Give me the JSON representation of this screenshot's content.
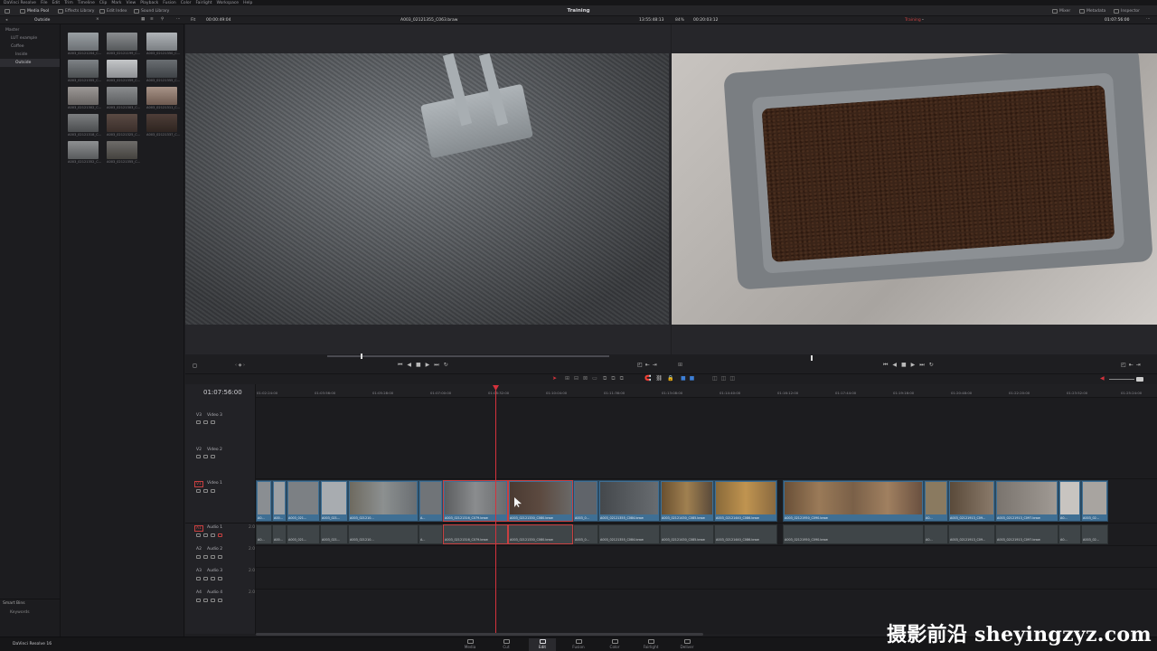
{
  "menubar": [
    "DaVinci Resolve",
    "File",
    "Edit",
    "Trim",
    "Timeline",
    "Clip",
    "Mark",
    "View",
    "Playback",
    "Fusion",
    "Color",
    "Fairlight",
    "Workspace",
    "Help"
  ],
  "toolbar": {
    "media_pool": "Media Pool",
    "effects": "Effects Library",
    "edit_index": "Edit Index",
    "sound_library": "Sound Library",
    "title": "Training",
    "mixer": "Mixer",
    "metadata": "Metadata",
    "inspector": "Inspector"
  },
  "subbar": {
    "bin_name": "Outside",
    "fit": "Fit",
    "source_tc": "00:00:49:04",
    "clip_name": "A003_02121355_C063.braw",
    "duration": "13:55:48:13",
    "zoom": "84%",
    "tl_tc_left": "00:20:03:12",
    "timeline_name": "Training",
    "record_tc": "01:07:56:00"
  },
  "bins": {
    "root": "Master",
    "items": [
      "LUT example",
      "Coffee",
      "Inside",
      "Outside"
    ],
    "selected": "Outside"
  },
  "smart_bins": {
    "title": "Smart Bins",
    "keywords": "Keywords"
  },
  "thumbs": [
    "A003_02121204_C...",
    "A003_02121199_C...",
    "A003_02121350_C...",
    "A003_02121355_C...",
    "A003_02121359_C...",
    "A003_02121355_C...",
    "A003_02121302_C...",
    "A003_02121303_C...",
    "A003_02121311_C...",
    "A003_02121318_C...",
    "A003_02121325_C...",
    "A003_02121337_C...",
    "A003_02121352_C...",
    "A003_02121355_C..."
  ],
  "timeline": {
    "timecode": "01:07:56:00",
    "ruler": [
      "01:02:24:00",
      "01:03:56:00",
      "01:05:28:00",
      "01:07:00:00",
      "01:08:32:00",
      "01:10:04:00",
      "01:11:36:00",
      "01:13:08:00",
      "01:14:40:00",
      "01:16:12:00",
      "01:17:44:00",
      "01:19:16:00",
      "01:20:48:00",
      "01:22:20:00",
      "01:23:52:00",
      "01:25:24:00"
    ],
    "tracks": {
      "v3": "V3",
      "v3_name": "Video 3",
      "v2": "V2",
      "v2_name": "Video 2",
      "v1": "V1",
      "v1_name": "Video 1",
      "a1": "A1",
      "a1_name": "Audio 1",
      "a2": "A2",
      "a2_name": "Audio 2",
      "a3": "A3",
      "a3_name": "Audio 3",
      "a4": "A4",
      "a4_name": "Audio 4",
      "ch": "2.0"
    },
    "clips": [
      "A0...",
      "A00...",
      "A003_021...",
      "A003_021...",
      "A003_021210...",
      "A...",
      "A003_02121316_C079.braw",
      "A003_02121330_C080.braw",
      "A003_0...",
      "A003_02121355_C084.braw",
      "A003_02121430_C085.braw",
      "A003_02121440_C086.braw",
      "A003_02121950_C090.braw",
      "A0...",
      "A003_02121913_C09...",
      "A003_02121913_C097.braw",
      "A0...",
      "A003_02..."
    ]
  },
  "version": "DaVinci Resolve 16",
  "pages": [
    "Media",
    "Cut",
    "Edit",
    "Fusion",
    "Color",
    "Fairlight",
    "Deliver"
  ],
  "active_page": "Edit",
  "watermark": "摄影前沿 sheyingzyz.com",
  "colors": {
    "accent_blue": "#3f6f94",
    "playhead": "#d4323c",
    "timeline_label_red": "#c84040"
  }
}
